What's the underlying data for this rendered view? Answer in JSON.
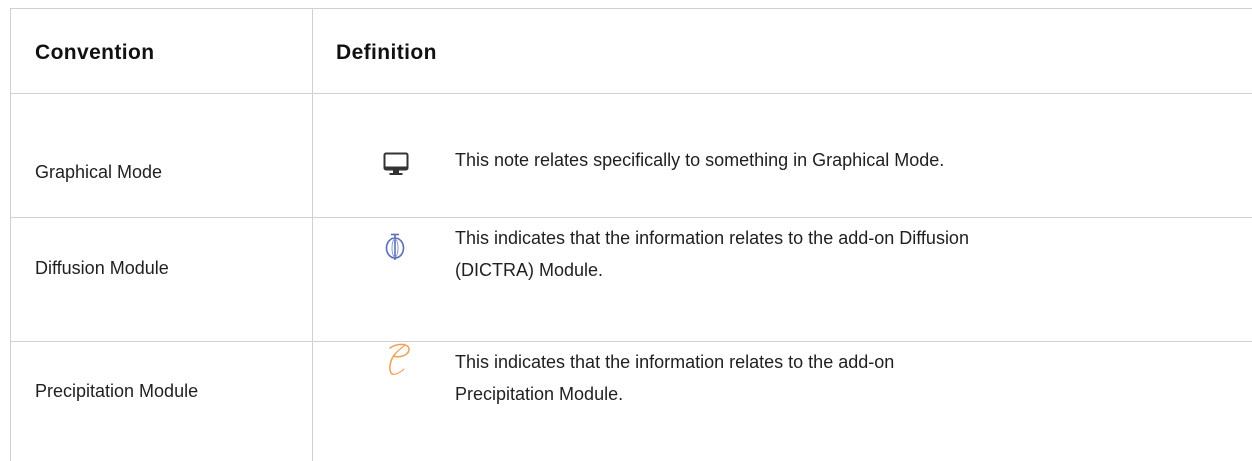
{
  "table": {
    "headers": {
      "convention": "Convention",
      "definition": "Definition"
    },
    "rows": [
      {
        "convention": "Graphical Mode",
        "icon": "monitor-icon",
        "definition_lines": [
          "This note relates specifically to something in Graphical Mode."
        ]
      },
      {
        "convention": "Diffusion Module",
        "icon": "diffusion-module-icon",
        "definition_lines": [
          "This indicates that the information relates to the add-on Diffusion",
          "(DICTRA) Module."
        ]
      },
      {
        "convention": "Precipitation Module",
        "icon": "precipitation-module-icon",
        "definition_lines": [
          "This indicates that the information relates to the add-on",
          "Precipitation Module."
        ]
      }
    ]
  },
  "colors": {
    "grid": "#d0d0d0",
    "text": "#1f1f1f",
    "monitor_icon": "#333333",
    "diffusion_icon": "#5a6fb8",
    "precipitation_icon": "#f0a255"
  }
}
